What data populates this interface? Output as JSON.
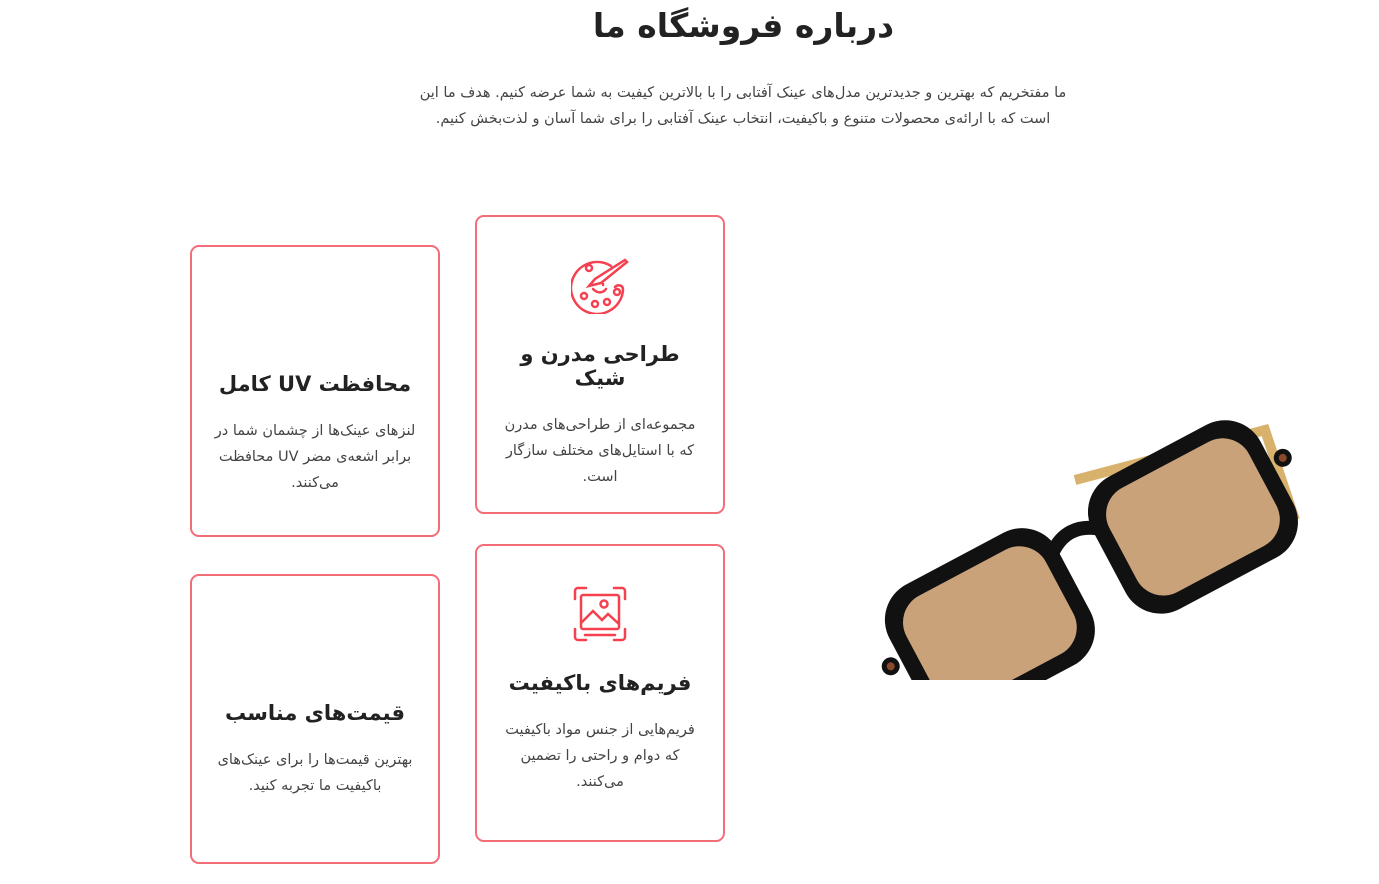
{
  "about": {
    "title": "درباره فروشگاه ما",
    "intro": "ما مفتخریم که بهترین و جدیدترین مدل‌های عینک آفتابی را با بالاترین کیفیت به شما عرضه کنیم. هدف ما این است که با ارائه‌ی محصولات متنوع و باکیفیت، انتخاب عینک آفتابی را برای شما آسان و لذت‌بخش کنیم."
  },
  "accent_color": "#f5404f",
  "features": [
    {
      "icon": "palette-icon",
      "title": "طراحی مدرن و شیک",
      "text": "مجموعه‌ای از طراحی‌های مدرن که با استایل‌های مختلف سازگار است."
    },
    {
      "icon": "",
      "title": "محافظت UV کامل",
      "text": "لنزهای عینک‌ها از چشمان شما در برابر اشعه‌ی مضر UV محافظت می‌کنند."
    },
    {
      "icon": "image-frame-icon",
      "title": "فریم‌های باکیفیت",
      "text": "فریم‌هایی از جنس مواد باکیفیت که دوام و راحتی را تضمین می‌کنند."
    },
    {
      "icon": "",
      "title": "قیمت‌های مناسب",
      "text": "بهترین قیمت‌ها را برای عینک‌های باکیفیت ما تجربه کنید."
    }
  ]
}
